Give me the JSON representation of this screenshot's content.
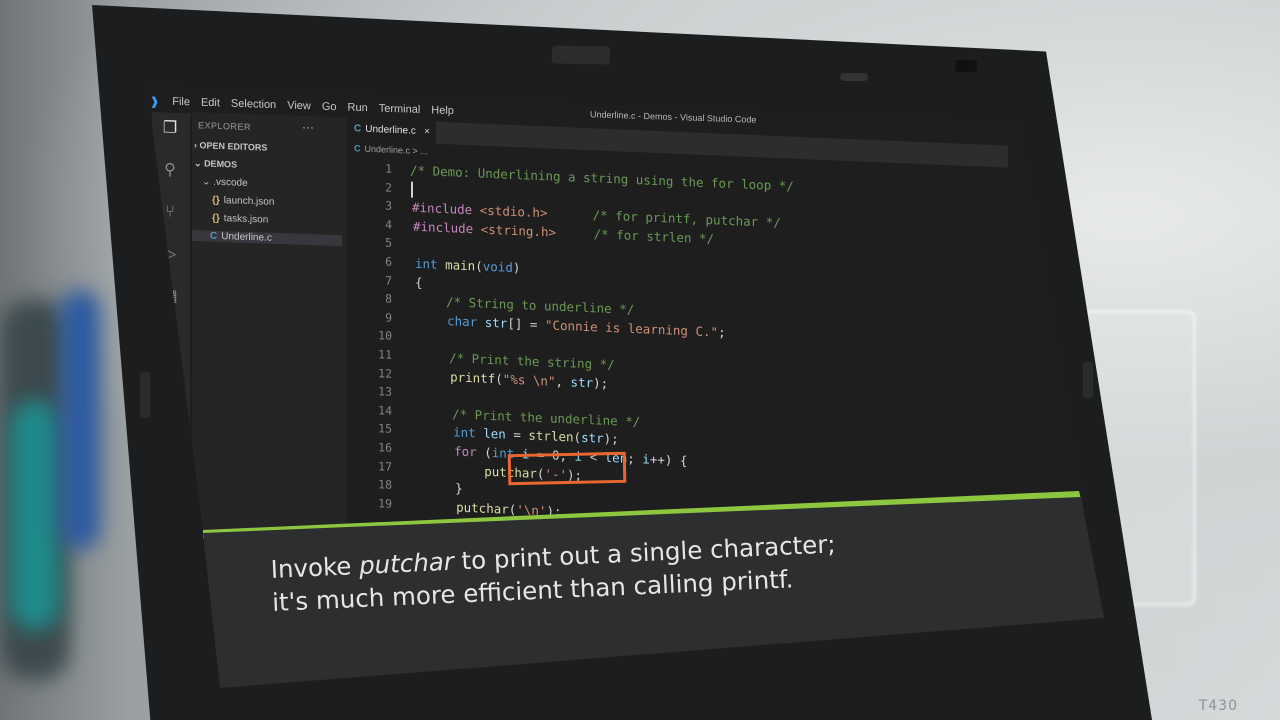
{
  "window": {
    "title": "Underline.c - Demos - Visual Studio Code"
  },
  "menu": [
    "File",
    "Edit",
    "Selection",
    "View",
    "Go",
    "Run",
    "Terminal",
    "Help"
  ],
  "sidebar": {
    "explorer_label": "EXPLORER",
    "more": "···",
    "open_editors": "OPEN EDITORS",
    "folder": "DEMOS",
    "subfolder": ".vscode",
    "files": [
      "launch.json",
      "tasks.json",
      "Underline.c"
    ]
  },
  "editor": {
    "tab": "Underline.c",
    "tab_close": "×",
    "breadcrumb": "Underline.c > ...",
    "lines": [
      {
        "n": "1",
        "html": "<span class='cm'>/* Demo: Underlining a string using the for loop */</span>"
      },
      {
        "n": "2",
        "html": ""
      },
      {
        "n": "3",
        "html": "<span class='pp'>#include</span> <span class='st'>&lt;stdio.h&gt;</span>      <span class='cm'>/* for printf, putchar */</span>"
      },
      {
        "n": "4",
        "html": "<span class='pp'>#include</span> <span class='st'>&lt;string.h&gt;</span>     <span class='cm'>/* for strlen */</span>"
      },
      {
        "n": "5",
        "html": ""
      },
      {
        "n": "6",
        "html": "<span class='kw'>int</span> <span class='fn'>main</span>(<span class='kw'>void</span>)"
      },
      {
        "n": "7",
        "html": "{"
      },
      {
        "n": "8",
        "html": "    <span class='cm'>/* String to underline */</span>"
      },
      {
        "n": "9",
        "html": "    <span class='kw'>char</span> <span class='id'>str</span>[] = <span class='st'>\"Connie is learning C.\"</span>;"
      },
      {
        "n": "10",
        "html": ""
      },
      {
        "n": "11",
        "html": "    <span class='cm'>/* Print the string */</span>"
      },
      {
        "n": "12",
        "html": "    <span class='fn'>printf</span>(<span class='st'>\"%s \\n\"</span>, <span class='id'>str</span>);"
      },
      {
        "n": "13",
        "html": ""
      },
      {
        "n": "14",
        "html": "    <span class='cm'>/* Print the underline */</span>"
      },
      {
        "n": "15",
        "html": "    <span class='kw'>int</span> <span class='id'>len</span> = <span class='fn'>strlen</span>(<span class='id'>str</span>);"
      },
      {
        "n": "16",
        "html": "    <span class='pp'>for</span> (<span class='kw'>int</span> <span class='id'>i</span> = 0; <span class='id'>i</span> &lt; <span class='id'>len</span>; <span class='id'>i</span>++) {"
      },
      {
        "n": "17",
        "html": "        <span class='fn'>putchar</span>(<span class='st'>'-'</span>);"
      },
      {
        "n": "18",
        "html": "    }"
      },
      {
        "n": "19",
        "html": "    <span class='fn'>putchar</span>(<span class='st'>'\\n'</span>);"
      }
    ]
  },
  "caption": {
    "before": "Invoke ",
    "emph": "putchar",
    "after_line1": " to print out a single character;",
    "line2": "it's much more efficient than calling printf."
  },
  "model_tag": "T430",
  "colors": {
    "accent_green": "#8dc63f",
    "highlight_orange": "#e8662f",
    "editor_bg": "#1e1e1e"
  }
}
